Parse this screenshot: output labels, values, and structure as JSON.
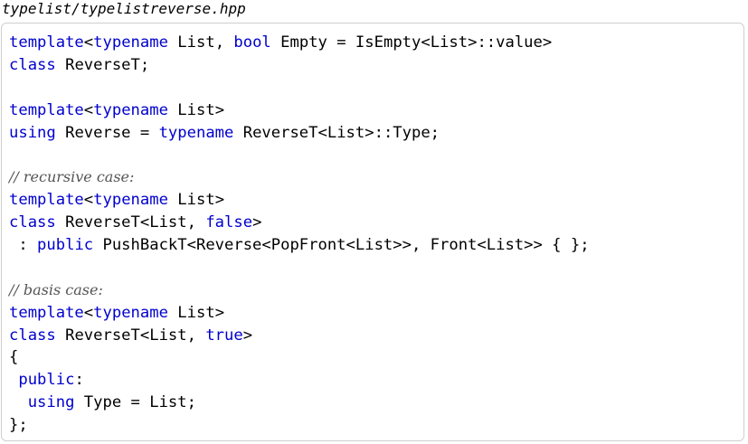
{
  "document": {
    "filename": "typelist/typelistreverse.hpp",
    "code_lines": [
      [
        {
          "t": "template",
          "k": "kw"
        },
        {
          "t": "<"
        },
        {
          "t": "typename",
          "k": "kw"
        },
        {
          "t": " List, "
        },
        {
          "t": "bool",
          "k": "kw"
        },
        {
          "t": " Empty = IsEmpty<List>::value>"
        }
      ],
      [
        {
          "t": "class",
          "k": "kw"
        },
        {
          "t": " ReverseT;"
        }
      ],
      [],
      [
        {
          "t": "template",
          "k": "kw"
        },
        {
          "t": "<"
        },
        {
          "t": "typename",
          "k": "kw"
        },
        {
          "t": " List>"
        }
      ],
      [
        {
          "t": "using",
          "k": "kw"
        },
        {
          "t": " Reverse = "
        },
        {
          "t": "typename",
          "k": "kw"
        },
        {
          "t": " ReverseT<List>::Type;"
        }
      ],
      [],
      [
        {
          "t": "// recursive case:",
          "k": "cm"
        }
      ],
      [
        {
          "t": "template",
          "k": "kw"
        },
        {
          "t": "<"
        },
        {
          "t": "typename",
          "k": "kw"
        },
        {
          "t": " List>"
        }
      ],
      [
        {
          "t": "class",
          "k": "kw"
        },
        {
          "t": " ReverseT<List, "
        },
        {
          "t": "false",
          "k": "kw"
        },
        {
          "t": ">"
        }
      ],
      [
        {
          "t": " : "
        },
        {
          "t": "public",
          "k": "kw"
        },
        {
          "t": " PushBackT<Reverse<PopFront<List>>, Front<List>> { };"
        }
      ],
      [],
      [
        {
          "t": "// basis case:",
          "k": "cm"
        }
      ],
      [
        {
          "t": "template",
          "k": "kw"
        },
        {
          "t": "<"
        },
        {
          "t": "typename",
          "k": "kw"
        },
        {
          "t": " List>"
        }
      ],
      [
        {
          "t": "class",
          "k": "kw"
        },
        {
          "t": " ReverseT<List, "
        },
        {
          "t": "true",
          "k": "kw"
        },
        {
          "t": ">"
        }
      ],
      [
        {
          "t": "{"
        }
      ],
      [
        {
          "t": " "
        },
        {
          "t": "public",
          "k": "kw"
        },
        {
          "t": ":"
        }
      ],
      [
        {
          "t": "  "
        },
        {
          "t": "using",
          "k": "kw"
        },
        {
          "t": " Type = List;"
        }
      ],
      [
        {
          "t": "};"
        }
      ]
    ]
  }
}
